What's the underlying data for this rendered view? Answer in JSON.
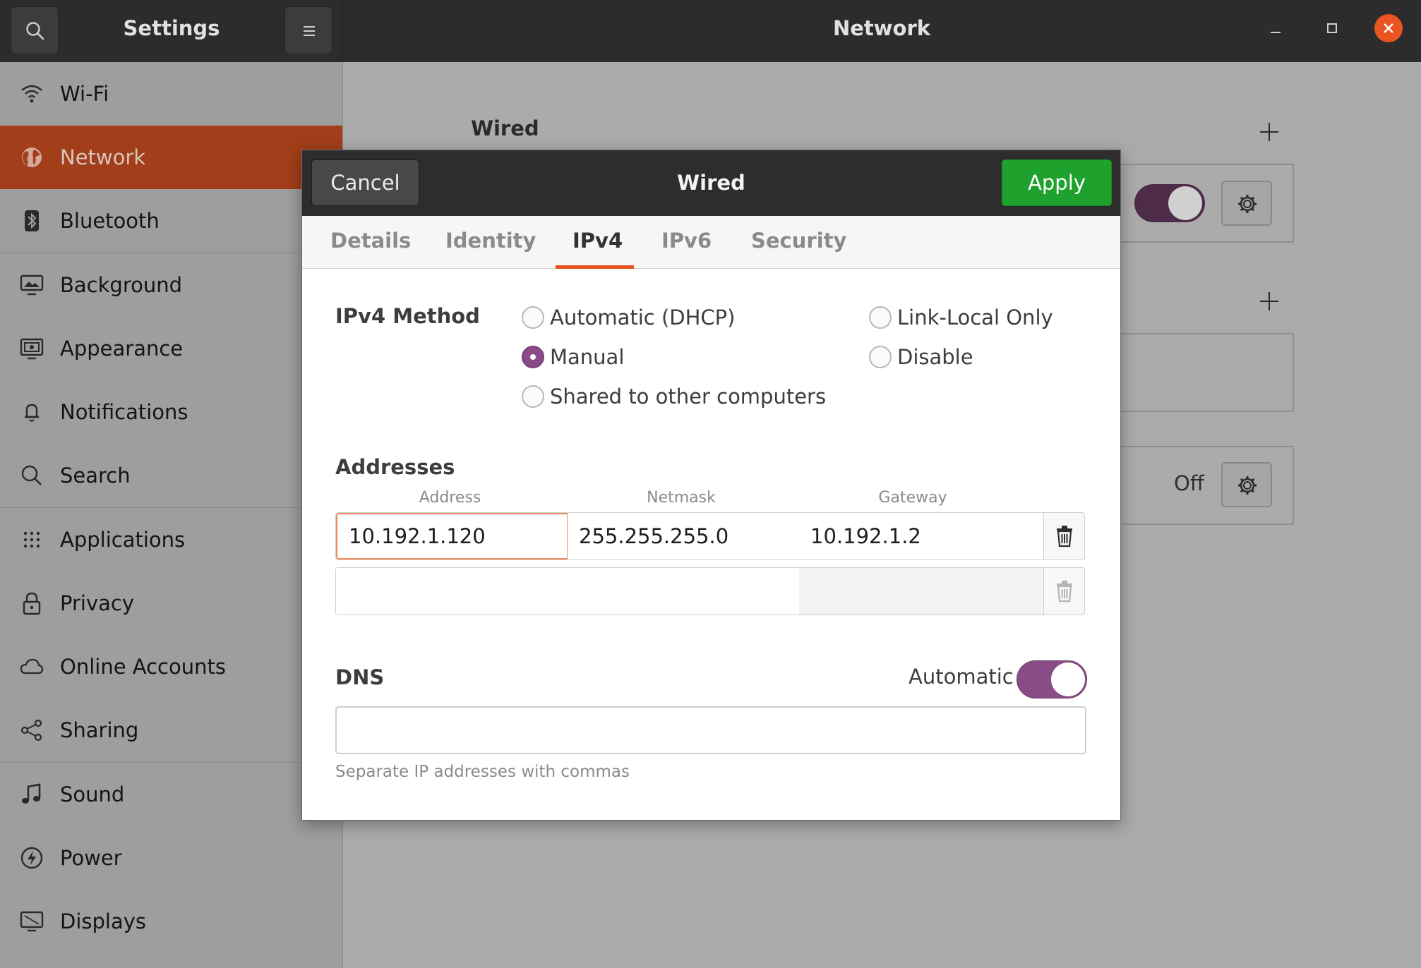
{
  "header": {
    "settings_title": "Settings",
    "panel_title": "Network"
  },
  "sidebar": {
    "items": [
      {
        "label": "Wi-Fi",
        "icon": "wifi-icon"
      },
      {
        "label": "Network",
        "icon": "globe-icon",
        "active": true
      },
      {
        "label": "Bluetooth",
        "icon": "bluetooth-icon"
      },
      {
        "label": "Background",
        "icon": "monitor-icon"
      },
      {
        "label": "Appearance",
        "icon": "appearance-icon"
      },
      {
        "label": "Notifications",
        "icon": "bell-icon"
      },
      {
        "label": "Search",
        "icon": "search-icon"
      },
      {
        "label": "Applications",
        "icon": "grid-icon"
      },
      {
        "label": "Privacy",
        "icon": "lock-icon"
      },
      {
        "label": "Online Accounts",
        "icon": "cloud-icon"
      },
      {
        "label": "Sharing",
        "icon": "share-icon"
      },
      {
        "label": "Sound",
        "icon": "music-note-icon"
      },
      {
        "label": "Power",
        "icon": "power-icon"
      },
      {
        "label": "Displays",
        "icon": "display-icon"
      }
    ]
  },
  "background": {
    "wired_title": "Wired",
    "off_label": "Off"
  },
  "dialog": {
    "title": "Wired",
    "cancel_label": "Cancel",
    "apply_label": "Apply",
    "tabs": [
      "Details",
      "Identity",
      "IPv4",
      "IPv6",
      "Security"
    ],
    "active_tab": "IPv4",
    "ipv4_method": {
      "label": "IPv4 Method",
      "options": [
        "Automatic (DHCP)",
        "Manual",
        "Shared to other computers",
        "Link-Local Only",
        "Disable"
      ],
      "selected": "Manual"
    },
    "addresses": {
      "label": "Addresses",
      "columns": [
        "Address",
        "Netmask",
        "Gateway"
      ],
      "rows": [
        {
          "address": "10.192.1.120",
          "netmask": "255.255.255.0",
          "gateway": "10.192.1.2"
        },
        {
          "address": "",
          "netmask": "",
          "gateway": ""
        }
      ]
    },
    "dns": {
      "label": "DNS",
      "automatic_label": "Automatic",
      "automatic_on": true,
      "value": "",
      "hint": "Separate IP addresses with commas"
    }
  },
  "colors": {
    "accent_orange": "#e95420",
    "apply_green": "#1fa12d",
    "toggle_purple": "#8a4c86"
  }
}
